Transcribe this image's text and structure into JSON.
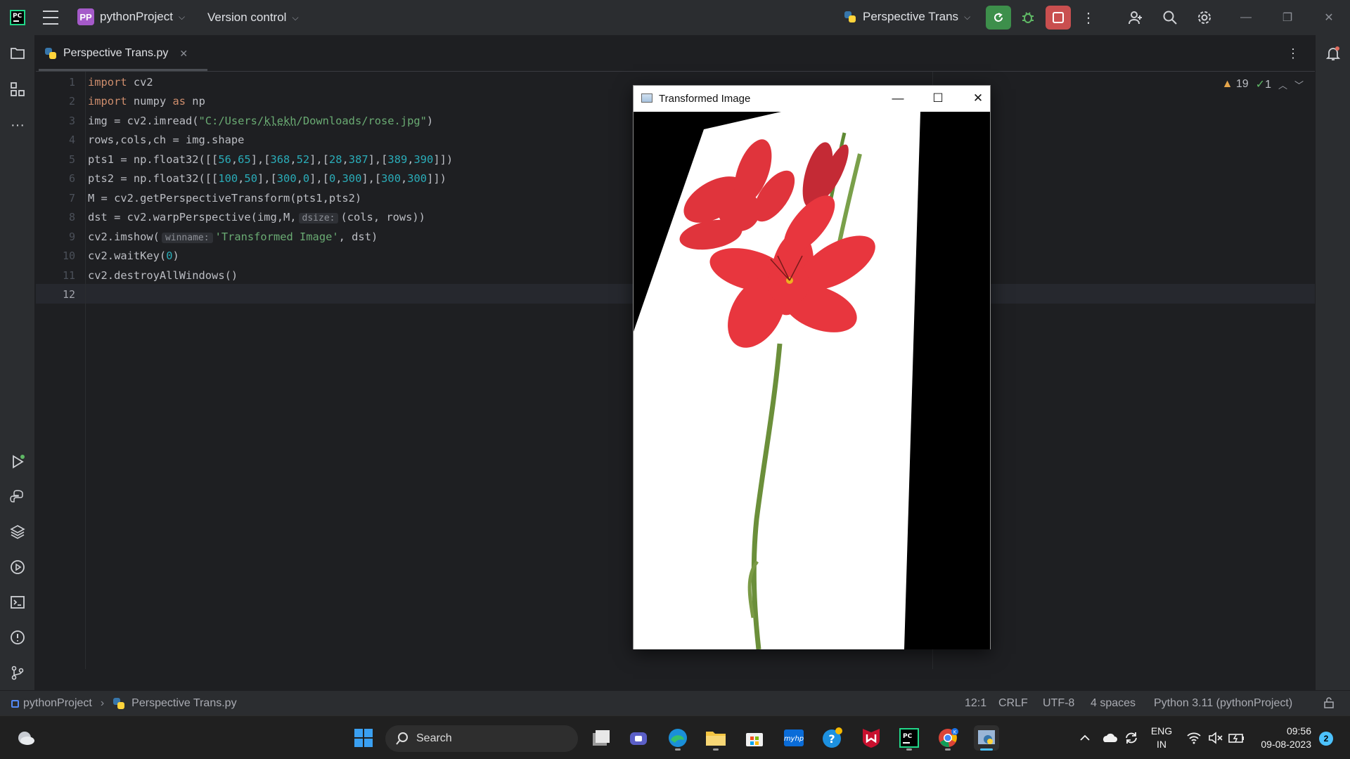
{
  "titlebar": {
    "logo": "PC",
    "project_badge": "PP",
    "project_name": "pythonProject",
    "version_control": "Version control",
    "run_config": "Perspective Trans"
  },
  "tab": {
    "file_name": "Perspective Trans.py"
  },
  "editor": {
    "line_numbers": [
      "1",
      "2",
      "3",
      "4",
      "5",
      "6",
      "7",
      "8",
      "9",
      "10",
      "11",
      "12"
    ],
    "current_line": "12",
    "inspections": {
      "warnings": "19",
      "ok": "1"
    },
    "code": {
      "l1": {
        "kw": "import",
        "rest": " cv2"
      },
      "l2": {
        "kw1": "import",
        "mid": " numpy ",
        "kw2": "as",
        "rest": " np"
      },
      "l3": {
        "pre": "img = cv2.imread(",
        "str_a": "\"C:/Users/",
        "str_b": "klekh",
        "str_c": "/Downloads/rose.jpg\"",
        "post": ")"
      },
      "l4": {
        "text": "rows,cols,ch = img.shape"
      },
      "l5": {
        "pre": "pts1 = np.float32([[",
        "n": [
          "56",
          "65",
          "368",
          "52",
          "28",
          "387",
          "389",
          "390"
        ],
        "post": "]])"
      },
      "l6": {
        "pre": "pts2 = np.float32([[",
        "n": [
          "100",
          "50",
          "300",
          "0",
          "0",
          "300",
          "300",
          "300"
        ],
        "post": "]])"
      },
      "l7": {
        "text": "M = cv2.getPerspectiveTransform(pts1,pts2)"
      },
      "l8": {
        "pre": "dst = cv2.warpPerspective(img,M,",
        "hint": "dsize:",
        "post": "(cols, rows))"
      },
      "l9": {
        "pre": "cv2.imshow(",
        "hint": "winname:",
        "str": "'Transformed Image'",
        "post": ", dst)"
      },
      "l10": {
        "pre": "cv2.waitKey(",
        "num": "0",
        "post": ")"
      },
      "l11": {
        "text": "cv2.destroyAllWindows()"
      }
    }
  },
  "image_window": {
    "title": "Transformed Image",
    "minimize": "—",
    "maximize": "☐",
    "close": "✕"
  },
  "statusbar": {
    "project": "pythonProject",
    "file": "Perspective Trans.py",
    "position": "12:1",
    "line_sep": "CRLF",
    "encoding": "UTF-8",
    "indent": "4 spaces",
    "interpreter": "Python 3.11 (pythonProject)"
  },
  "taskbar": {
    "search_placeholder": "Search",
    "lang_top": "ENG",
    "lang_bottom": "IN",
    "time": "09:56",
    "date": "09-08-2023",
    "notifications": "2"
  },
  "colors": {
    "ide_bg": "#1e1f22",
    "ide_panel": "#2b2d30",
    "keyword": "#cf8e6d",
    "string": "#6aab73",
    "number": "#2aacb8",
    "rerun_green": "#3d8f4b",
    "stop_red": "#c94f4f",
    "flower_red": "#e0343c"
  },
  "icons": {
    "leftbar": [
      "folder-icon",
      "structure-icon",
      "more-icon",
      "run-icon",
      "python-console-icon",
      "layers-icon",
      "services-icon",
      "terminal-icon",
      "problems-icon",
      "git-icon"
    ],
    "rightbar": [
      "notifications-icon"
    ],
    "taskbar": [
      "weather-icon",
      "windows-start-icon",
      "search-icon",
      "task-view-icon",
      "meet-icon",
      "edge-icon",
      "file-explorer-icon",
      "store-icon",
      "myhp-icon",
      "help-icon",
      "mcafee-icon",
      "pycharm-icon",
      "chrome-icon",
      "python-window-icon"
    ]
  }
}
